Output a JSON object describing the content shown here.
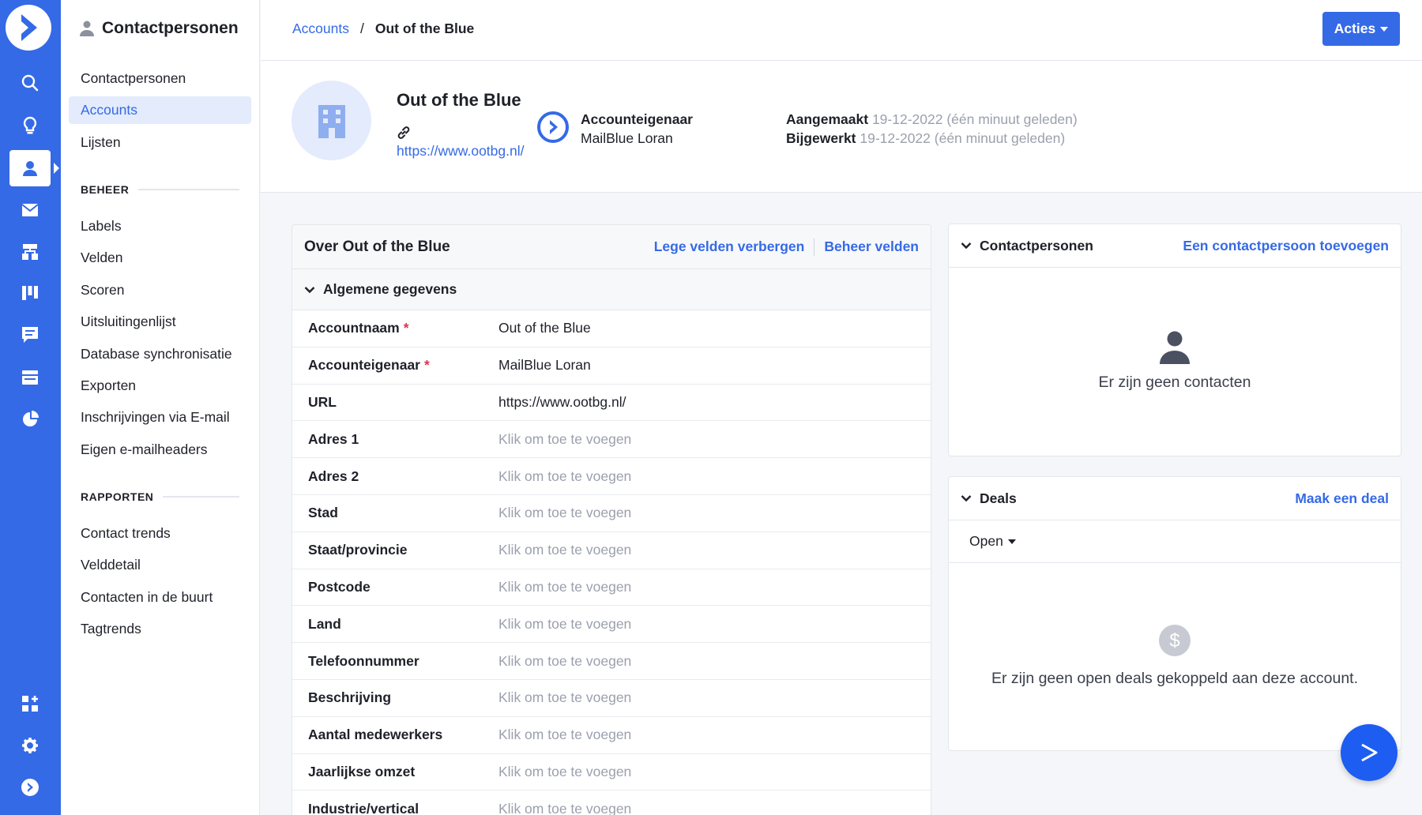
{
  "rail": {
    "items": [
      {
        "name": "search"
      },
      {
        "name": "lightbulb"
      },
      {
        "name": "contacts",
        "active": true
      },
      {
        "name": "email"
      },
      {
        "name": "automations"
      },
      {
        "name": "deals"
      },
      {
        "name": "conversations"
      },
      {
        "name": "website"
      },
      {
        "name": "reports"
      }
    ],
    "bottom": [
      {
        "name": "apps"
      },
      {
        "name": "settings"
      },
      {
        "name": "brand"
      }
    ]
  },
  "subnav": {
    "title": "Contactpersonen",
    "items": [
      {
        "label": "Contactpersonen"
      },
      {
        "label": "Accounts",
        "active": true
      },
      {
        "label": "Lijsten"
      }
    ],
    "beheer_title": "BEHEER",
    "beheer": [
      {
        "label": "Labels"
      },
      {
        "label": "Velden"
      },
      {
        "label": "Scoren"
      },
      {
        "label": "Uitsluitingenlijst"
      },
      {
        "label": "Database synchronisatie"
      },
      {
        "label": "Exporten"
      },
      {
        "label": "Inschrijvingen via E-mail"
      },
      {
        "label": "Eigen e-mailheaders"
      }
    ],
    "rapporten_title": "RAPPORTEN",
    "rapporten": [
      {
        "label": "Contact trends"
      },
      {
        "label": "Velddetail"
      },
      {
        "label": "Contacten in de buurt"
      },
      {
        "label": "Tagtrends"
      }
    ]
  },
  "breadcrumb": {
    "parent": "Accounts",
    "separator": "/",
    "current": "Out of the Blue"
  },
  "actions_label": "Acties",
  "account": {
    "name": "Out of the Blue",
    "url": "https://www.ootbg.nl/",
    "owner_label": "Accounteigenaar",
    "owner_value": "MailBlue Loran",
    "created_label": "Aangemaakt",
    "created_value": "19-12-2022 (één minuut geleden)",
    "updated_label": "Bijgewerkt",
    "updated_value": "19-12-2022 (één minuut geleden)"
  },
  "about": {
    "title": "Over Out of the Blue",
    "hide_empty_label": "Lege velden verbergen",
    "manage_fields_label": "Beheer velden",
    "section_title": "Algemene gegevens",
    "fields": [
      {
        "label": "Accountnaam",
        "required": "*",
        "value": "Out of the Blue",
        "empty": false
      },
      {
        "label": "Accounteigenaar",
        "required": "*",
        "value": "MailBlue Loran",
        "empty": false
      },
      {
        "label": "URL",
        "required": "",
        "value": "https://www.ootbg.nl/",
        "empty": false
      },
      {
        "label": "Adres 1",
        "required": "",
        "value": "Klik om toe te voegen",
        "empty": true
      },
      {
        "label": "Adres 2",
        "required": "",
        "value": "Klik om toe te voegen",
        "empty": true
      },
      {
        "label": "Stad",
        "required": "",
        "value": "Klik om toe te voegen",
        "empty": true
      },
      {
        "label": "Staat/provincie",
        "required": "",
        "value": "Klik om toe te voegen",
        "empty": true
      },
      {
        "label": "Postcode",
        "required": "",
        "value": "Klik om toe te voegen",
        "empty": true
      },
      {
        "label": "Land",
        "required": "",
        "value": "Klik om toe te voegen",
        "empty": true
      },
      {
        "label": "Telefoonnummer",
        "required": "",
        "value": "Klik om toe te voegen",
        "empty": true
      },
      {
        "label": "Beschrijving",
        "required": "",
        "value": "Klik om toe te voegen",
        "empty": true
      },
      {
        "label": "Aantal medewerkers",
        "required": "",
        "value": "Klik om toe te voegen",
        "empty": true
      },
      {
        "label": "Jaarlijkse omzet",
        "required": "",
        "value": "Klik om toe te voegen",
        "empty": true
      },
      {
        "label": "Industrie/vertical",
        "required": "",
        "value": "Klik om toe te voegen",
        "empty": true
      }
    ]
  },
  "contacts_panel": {
    "title": "Contactpersonen",
    "add_label": "Een contactpersoon toevoegen",
    "empty_text": "Er zijn geen contacten"
  },
  "deals_panel": {
    "title": "Deals",
    "add_label": "Maak een deal",
    "filter_value": "Open",
    "empty_text": "Er zijn geen open deals gekoppeld aan deze account."
  },
  "colors": {
    "accent": "#356ae6",
    "rail": "#356ae6",
    "required": "#d9364c",
    "muted": "#9ba0ad"
  }
}
